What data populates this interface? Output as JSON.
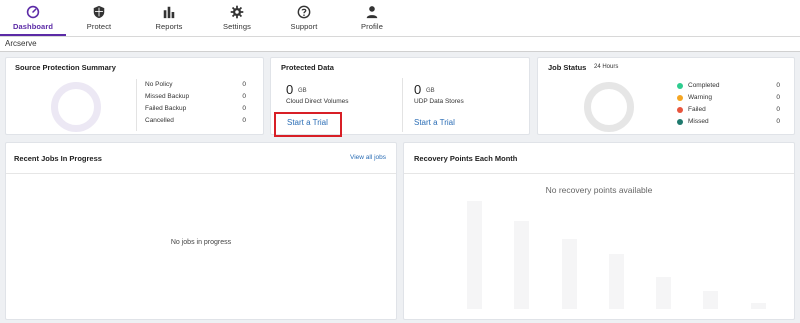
{
  "nav": {
    "items": [
      {
        "label": "Dashboard",
        "icon": "gauge-icon",
        "active": true
      },
      {
        "label": "Protect",
        "icon": "shield-icon",
        "active": false
      },
      {
        "label": "Reports",
        "icon": "bar-chart-icon",
        "active": false
      },
      {
        "label": "Settings",
        "icon": "gear-icon",
        "active": false
      },
      {
        "label": "Support",
        "icon": "help-circle-icon",
        "active": false
      },
      {
        "label": "Profile",
        "icon": "person-icon",
        "active": false
      }
    ],
    "accent_color": "#5b2aa6"
  },
  "breadcrumb": "Arcserve",
  "source_protection": {
    "title": "Source Protection Summary",
    "rows": [
      {
        "label": "No Policy",
        "value": "0"
      },
      {
        "label": "Missed Backup",
        "value": "0"
      },
      {
        "label": "Failed Backup",
        "value": "0"
      },
      {
        "label": "Cancelled",
        "value": "0"
      }
    ],
    "ring_color": "#ece8f4"
  },
  "protected_data": {
    "title": "Protected Data",
    "left": {
      "value": "0",
      "unit": "GB",
      "label": "Cloud Direct Volumes",
      "link": "Start a Trial"
    },
    "right": {
      "value": "0",
      "unit": "GB",
      "label": "UDP Data Stores",
      "link": "Start a Trial"
    },
    "highlight_color": "#d81f26"
  },
  "job_status": {
    "title": "Job Status",
    "period": "24 Hours",
    "rows": [
      {
        "label": "Completed",
        "value": "0",
        "color": "#2ecc8f"
      },
      {
        "label": "Warning",
        "value": "0",
        "color": "#f5a623"
      },
      {
        "label": "Failed",
        "value": "0",
        "color": "#e8553d"
      },
      {
        "label": "Missed",
        "value": "0",
        "color": "#1f7a6e"
      }
    ],
    "ring_color": "#e6e6e6"
  },
  "recent_jobs": {
    "title": "Recent Jobs In Progress",
    "view_all": "View all jobs",
    "empty": "No jobs in progress"
  },
  "recovery_points": {
    "title": "Recovery Points Each Month",
    "empty": "No recovery points available"
  }
}
